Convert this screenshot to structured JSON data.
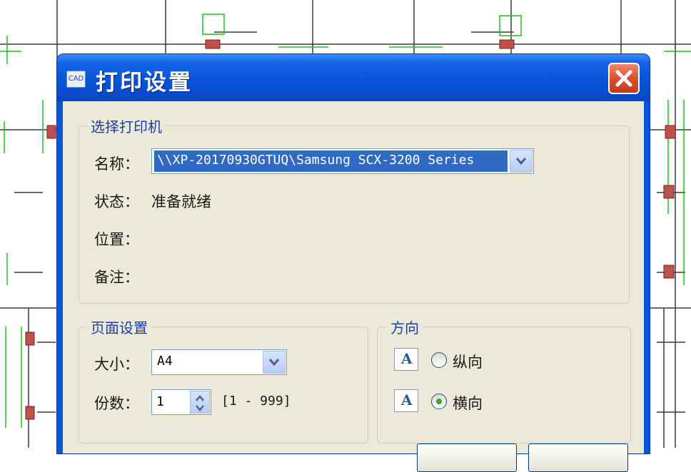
{
  "dialog": {
    "title": "打印设置",
    "app_icon": "cad-app-icon",
    "close_icon": "close-icon"
  },
  "printer_group": {
    "label": "选择打印机",
    "name_label": "名称：",
    "name_value": "\\\\XP-20170930GTUQ\\Samsung SCX-3200 Series",
    "status_label": "状态：",
    "status_value": "准备就绪",
    "location_label": "位置：",
    "comment_label": "备注："
  },
  "page_group": {
    "label": "页面设置",
    "size_label": "大小：",
    "size_value": "A4",
    "copies_label": "份数：",
    "copies_value": "1",
    "copies_range": "[1 - 999]"
  },
  "orientation_group": {
    "label": "方向",
    "icon_letter": "A",
    "portrait_label": "纵向",
    "landscape_label": "横向",
    "selected": "landscape"
  },
  "colors": {
    "title_bar": "#0a54d8",
    "client": "#ece9d8",
    "group_label": "#1a3fa8",
    "selection": "#316ac5",
    "close_button": "#dc4f2c"
  }
}
